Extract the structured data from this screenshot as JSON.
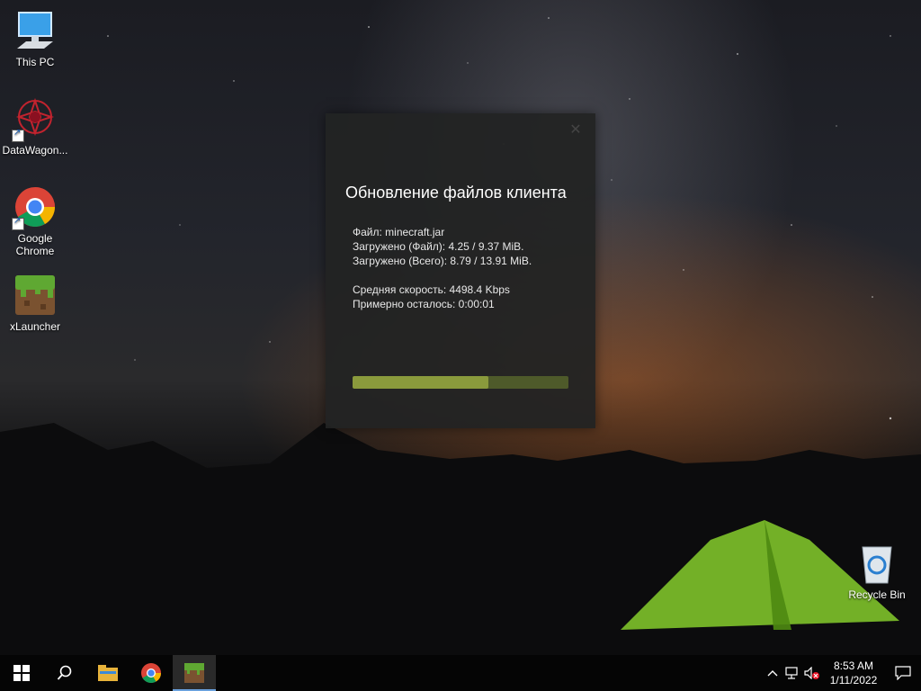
{
  "desktop": {
    "icons": [
      {
        "label": "This PC",
        "icon": "computer-icon"
      },
      {
        "label": "DataWagon...",
        "icon": "datawagon-icon"
      },
      {
        "label": "Google Chrome",
        "icon": "chrome-icon"
      },
      {
        "label": "xLauncher",
        "icon": "minecraft-grass-icon"
      },
      {
        "label": "Recycle Bin",
        "icon": "recycle-bin-icon"
      }
    ]
  },
  "dialog": {
    "title": "Обновление файлов клиента",
    "file_line": "Файл: minecraft.jar",
    "downloaded_file_line": "Загружено (Файл): 4.25 / 9.37 MiB.",
    "downloaded_total_line": "Загружено (Всего): 8.79 / 13.91 MiB.",
    "speed_line": "Средняя скорость: 4498.4 Kbps",
    "remaining_line": "Примерно осталось: 0:00:01",
    "progress": 0.63,
    "colors": {
      "track": "#4e5a2a",
      "fill": "#8a9a3c"
    }
  },
  "taskbar": {
    "items": [
      "start-icon",
      "search-icon",
      "file-explorer-icon",
      "chrome-icon",
      "minecraft-grass-icon"
    ],
    "active": "minecraft-grass-icon",
    "clock_time": "8:53 AM",
    "clock_date": "1/11/2022"
  }
}
